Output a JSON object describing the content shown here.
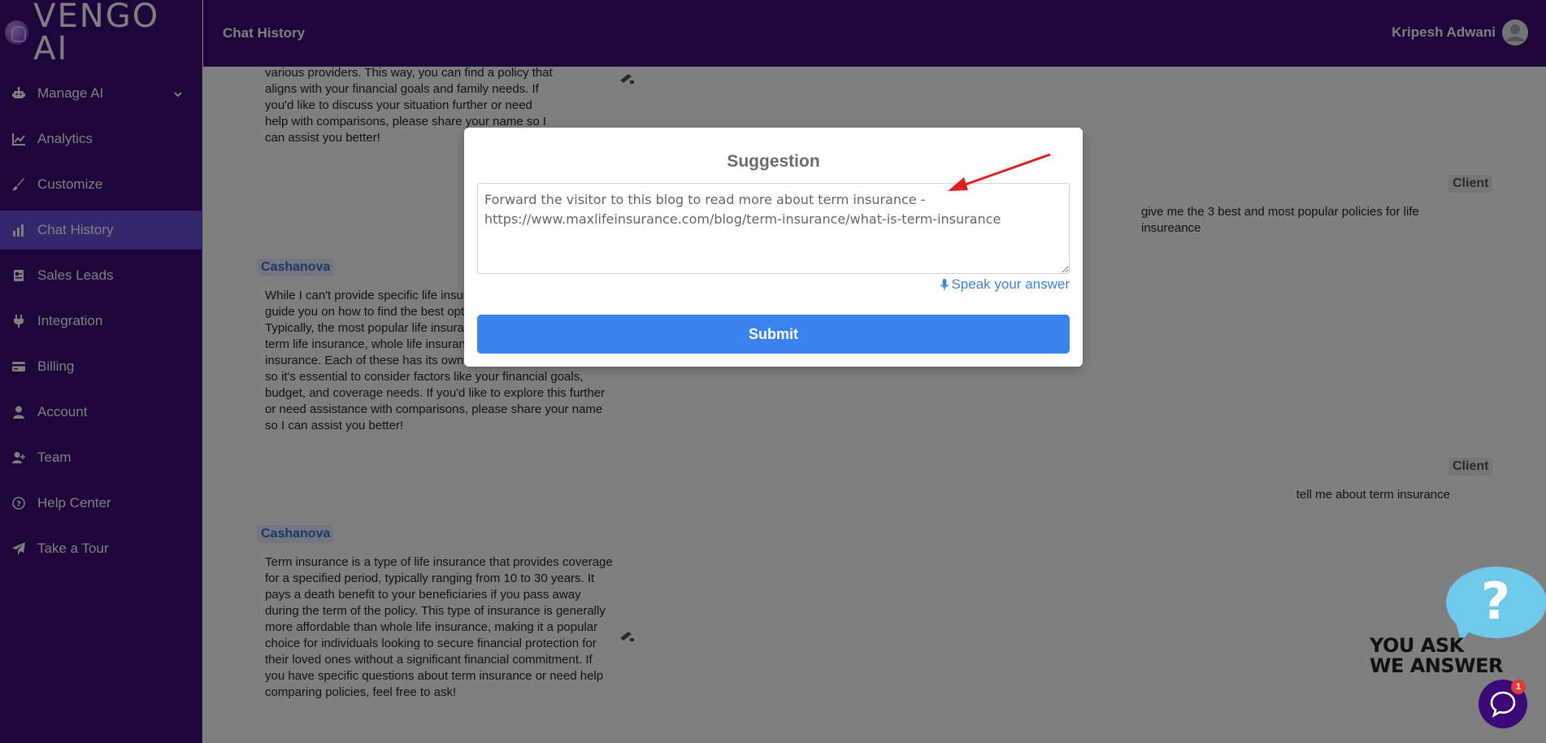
{
  "brand": {
    "logo_text": "VENGO AI"
  },
  "header": {
    "title": "Chat History",
    "user_name": "Kripesh Adwani"
  },
  "sidebar": {
    "items": [
      {
        "label": "Manage AI",
        "icon": "robot-icon"
      },
      {
        "label": "Analytics",
        "icon": "line-chart-icon"
      },
      {
        "label": "Customize",
        "icon": "brush-icon"
      },
      {
        "label": "Chat History",
        "icon": "bar-chart-icon",
        "active": true
      },
      {
        "label": "Sales Leads",
        "icon": "address-card-icon"
      },
      {
        "label": "Integration",
        "icon": "plug-icon"
      },
      {
        "label": "Billing",
        "icon": "credit-card-icon"
      },
      {
        "label": "Account",
        "icon": "user-icon"
      },
      {
        "label": "Team",
        "icon": "user-plus-icon"
      },
      {
        "label": "Help Center",
        "icon": "question-circle-icon"
      },
      {
        "label": "Take a Tour",
        "icon": "paper-plane-icon"
      }
    ]
  },
  "chat": {
    "agent_name": "Cashanova",
    "client_name": "Client",
    "messages": [
      {
        "role": "agent",
        "text": "various providers. This way, you can find a policy that aligns with your financial goals and family needs. If you'd like to discuss your situation further or need help with comparisons, please share your name so I can assist you better!"
      },
      {
        "role": "client",
        "text": "give me the 3 best and most popular policies for life insureance"
      },
      {
        "role": "agent",
        "text": "While I can't provide specific life insurance policy names, I can guide you on how to find the best options for your needs. Typically, the most popular life insurance policy types include term life insurance, whole life insurance, and universal life insurance. Each of these has its own benefits and drawbacks, so it's essential to consider factors like your financial goals, budget, and coverage needs. If you'd like to explore this further or need assistance with comparisons, please share your name so I can assist you better!"
      },
      {
        "role": "client",
        "text": "tell me about term insurance"
      },
      {
        "role": "agent",
        "text": "Term insurance is a type of life insurance that provides coverage for a specified period, typically ranging from 10 to 30 years. It pays a death benefit to your beneficiaries if you pass away during the term of the policy. This type of insurance is generally more affordable than whole life insurance, making it a popular choice for individuals looking to secure financial protection for their loved ones without a significant financial commitment. If you have specific questions about term insurance or need help comparing policies, feel free to ask!"
      }
    ]
  },
  "modal": {
    "title": "Suggestion",
    "textarea_value": "Forward the visitor to this blog to read more about term insurance - https://www.maxlifeinsurance.com/blog/term-insurance/what-is-term-insurance",
    "speak_label": "Speak your answer",
    "submit_label": "Submit"
  },
  "widget": {
    "ask_line1": "YOU ASK",
    "ask_line2": "WE ANSWER",
    "question_mark": "?",
    "badge_count": "1"
  },
  "colors": {
    "sidebar_bg": "#3c0a78",
    "active_item_bg": "#6a4fd6",
    "submit_bg": "#3a82ee",
    "agent_tag": "#3c6ed6",
    "annotation_arrow": "#e02020"
  }
}
